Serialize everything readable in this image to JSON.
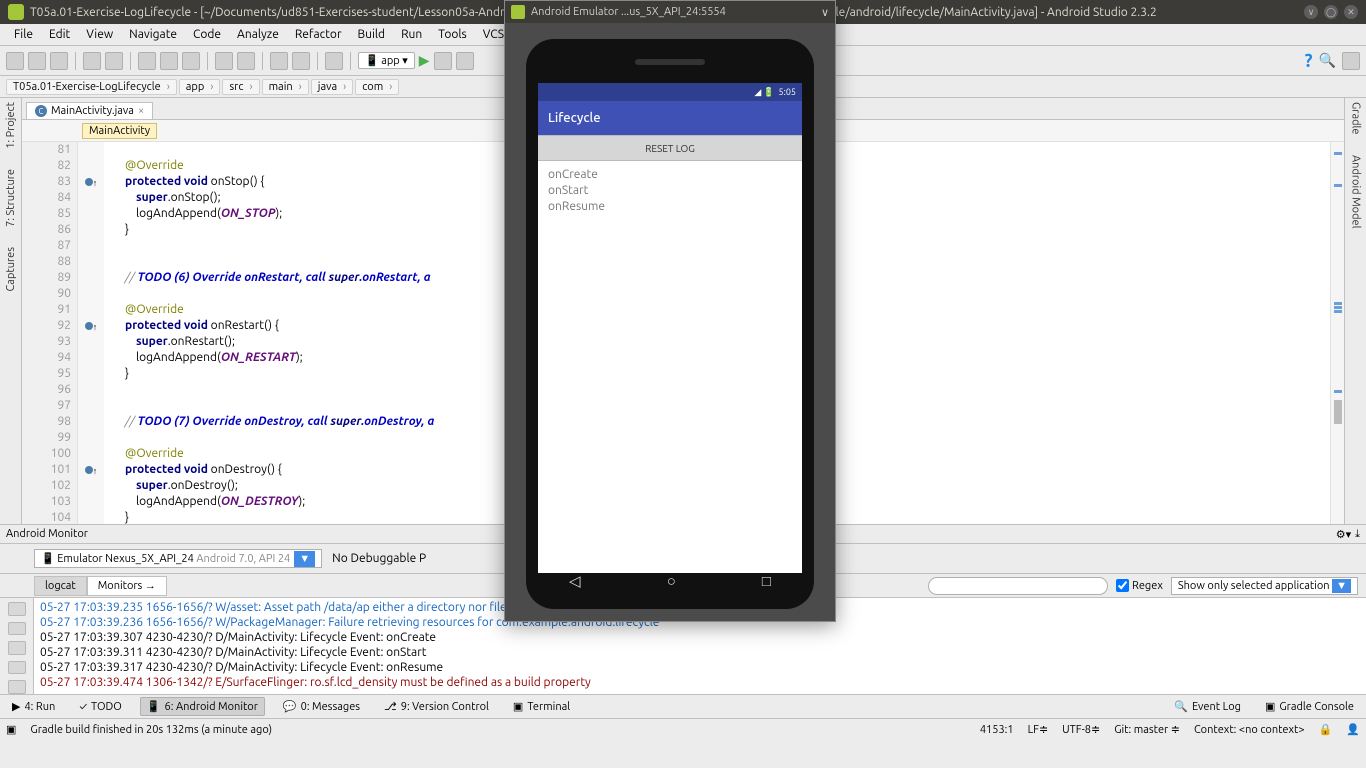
{
  "titlebar": {
    "text": "T05a.01-Exercise-LogLifecycle - [~/Documents/ud851-Exercises-student/Lesson05a-Android-Lifecycle/T05a.01-Exercise/app/src/main/java/com/example/android/lifecycle/MainActivity.java] - Android Studio 2.3.2"
  },
  "menu": [
    "File",
    "Edit",
    "View",
    "Navigate",
    "Code",
    "Analyze",
    "Refactor",
    "Build",
    "Run",
    "Tools",
    "VCS"
  ],
  "run_config": "app",
  "breadcrumbs": [
    "T05a.01-Exercise-LogLifecycle",
    "app",
    "src",
    "main",
    "java",
    "com"
  ],
  "tab": {
    "name": "MainActivity.java"
  },
  "class_crumb": "MainActivity",
  "lines": [
    {
      "n": 81,
      "t": "",
      "m": ""
    },
    {
      "n": 82,
      "t": "    @Override",
      "cls": "an"
    },
    {
      "n": 83,
      "t": "    protected void onStop() {",
      "kw": true,
      "m": "o"
    },
    {
      "n": 84,
      "t": "        super.onStop();"
    },
    {
      "n": 85,
      "t": "        logAndAppend(ON_STOP);",
      "cn": true
    },
    {
      "n": 86,
      "t": "    }"
    },
    {
      "n": 87,
      "t": "",
      "hl": true
    },
    {
      "n": 88,
      "t": ""
    },
    {
      "n": 89,
      "t": "    // TODO (6) Override onRestart, call super.onRestart, a",
      "cls": "cm tc"
    },
    {
      "n": 90,
      "t": ""
    },
    {
      "n": 91,
      "t": "    @Override",
      "cls": "an"
    },
    {
      "n": 92,
      "t": "    protected void onRestart() {",
      "kw": true,
      "m": "o"
    },
    {
      "n": 93,
      "t": "        super.onRestart();"
    },
    {
      "n": 94,
      "t": "        logAndAppend(ON_RESTART);",
      "cn": true
    },
    {
      "n": 95,
      "t": "    }"
    },
    {
      "n": 96,
      "t": ""
    },
    {
      "n": 97,
      "t": ""
    },
    {
      "n": 98,
      "t": "    // TODO (7) Override onDestroy, call super.onDestroy, a",
      "cls": "cm tc"
    },
    {
      "n": 99,
      "t": ""
    },
    {
      "n": 100,
      "t": "    @Override",
      "cls": "an"
    },
    {
      "n": 101,
      "t": "    protected void onDestroy() {",
      "kw": true,
      "m": "o"
    },
    {
      "n": 102,
      "t": "        super.onDestroy();"
    },
    {
      "n": 103,
      "t": "        logAndAppend(ON_DESTROY);",
      "cn": true
    },
    {
      "n": 104,
      "t": "    }"
    }
  ],
  "left_tools": [
    "1: Project",
    "7: Structure",
    "Captures"
  ],
  "right_tools": [
    "Gradle",
    "Android Model"
  ],
  "monitor": {
    "title": "Android Monitor",
    "device": "Emulator Nexus_5X_API_24",
    "api": "Android 7.0, API 24",
    "nodebug": "No Debuggable P",
    "tabs": [
      "logcat",
      "Monitors →"
    ],
    "regex_label": "Regex",
    "filter_sel": "Show only selected application",
    "log": [
      {
        "lvl": "w",
        "t": "05-27 17:03:39.235 1656-1656/? W/asset: Asset path /data/ap                                             either a directory nor file (type=1)."
      },
      {
        "lvl": "w",
        "t": "05-27 17:03:39.236 1656-1656/? W/PackageManager: Failure retrieving resources for com.example.android.lifecycle"
      },
      {
        "lvl": "d",
        "t": "05-27 17:03:39.307 4230-4230/? D/MainActivity: Lifecycle Event: onCreate"
      },
      {
        "lvl": "d",
        "t": "05-27 17:03:39.311 4230-4230/? D/MainActivity: Lifecycle Event: onStart"
      },
      {
        "lvl": "d",
        "t": "05-27 17:03:39.317 4230-4230/? D/MainActivity: Lifecycle Event: onResume"
      },
      {
        "lvl": "e",
        "t": "05-27 17:03:39.474 1306-1342/? E/SurfaceFlinger: ro.sf.lcd_density must be defined as a build property"
      }
    ]
  },
  "bottom_tabs": {
    "run": "4: Run",
    "todo": "TODO",
    "monitor": "6: Android Monitor",
    "msgs": "0: Messages",
    "vcs": "9: Version Control",
    "term": "Terminal",
    "evlog": "Event Log",
    "grcon": "Gradle Console"
  },
  "status": {
    "msg": "Gradle build finished in 20s 132ms (a minute ago)",
    "pos": "4153:1",
    "le": "LF≑",
    "enc": "UTF-8≑",
    "git": "Git: master ≑",
    "ctx": "Context: <no context>"
  },
  "emulator": {
    "title": "Android Emulator ...us_5X_API_24:5554",
    "clock": "5:05",
    "app_title": "Lifecycle",
    "reset": "RESET LOG",
    "events": [
      "onCreate",
      "onStart",
      "onResume"
    ]
  }
}
